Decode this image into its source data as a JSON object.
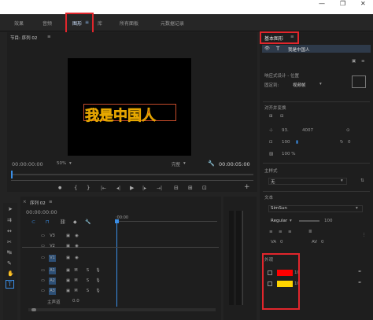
{
  "titlebar": {
    "minimize": "—",
    "restore": "❐",
    "close": "✕"
  },
  "workspaces": [
    "效果",
    "音频",
    "图形",
    "库",
    "所有面板",
    "元数据记录"
  ],
  "workspace_menu": "≡",
  "program_monitor": {
    "title": "节目: 序列 02",
    "menu": "≡",
    "canvas_text": "我是中国人",
    "timecode_in": "00:00:00:00",
    "zoom": "50%",
    "quality": "完整",
    "timecode_out": "00:00:05:00"
  },
  "transport": [
    "●",
    "{",
    "}",
    "|←",
    "◂|",
    "▶",
    "|▸",
    "→|",
    "⊟",
    "⊞",
    "⊡",
    "+"
  ],
  "timeline": {
    "title": "序列 02",
    "menu": "≡",
    "timecode": "00:00:00:00",
    "ruler_label": ":00:00",
    "tracks": [
      {
        "name": "V3"
      },
      {
        "name": "V2"
      },
      {
        "name": "V1"
      },
      {
        "name": "A1",
        "m": "M",
        "s": "S"
      },
      {
        "name": "A2",
        "m": "M",
        "s": "S"
      },
      {
        "name": "A3",
        "m": "M",
        "s": "S"
      }
    ],
    "master": "主声道",
    "master_value": "0.0"
  },
  "essential_graphics": {
    "title": "基本图形",
    "menu": "≡",
    "layer_name": "我是中国人",
    "responsive_section": "响应式设计 - 位置",
    "pin_label": "固定到:",
    "pin_value": "视频帧",
    "align_section": "对齐并变换",
    "pos_x": "93.",
    "pos_y": "4007",
    "scale_lock": "100",
    "rotation": "0",
    "opacity": "100 %",
    "master_style_section": "主样式",
    "master_style_value": "无",
    "text_section": "文本",
    "font": "SimSun",
    "font_style": "Regular",
    "font_size": "100",
    "tracking": "0",
    "kerning": "0",
    "appearance_section": "外观",
    "fill_color": "#ff0000",
    "stroke_color": "#ffd400",
    "stroke_value": "10",
    "fill_value": "10"
  },
  "colors": {
    "accent_blue": "#3a8ee6",
    "highlight_red": "#e1262c",
    "canvas_text": "#c81e1e",
    "canvas_outline": "#e6a800"
  }
}
